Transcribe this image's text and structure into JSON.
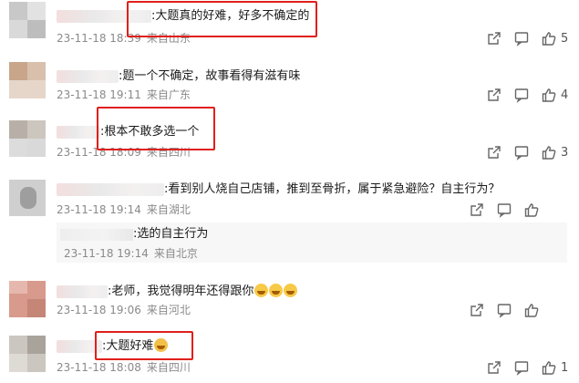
{
  "comments": [
    {
      "text": ":大题真的好难，好多不确定的",
      "date": "23-11-18 18:39",
      "location": "来自山东",
      "likes": "5"
    },
    {
      "text": ":题一个不确定，故事看得有滋有味",
      "date": "23-11-18 19:11",
      "location": "来自广东",
      "likes": "4"
    },
    {
      "text": ":根本不敢多选一个",
      "date": "23-11-18 18:09",
      "location": "来自四川",
      "likes": "3"
    },
    {
      "text": ":看到别人烧自己店铺，推到至骨折，属于紧急避险？自主行为？",
      "date": "23-11-18 19:14",
      "location": "来自湖北",
      "likes": ""
    },
    {
      "text": ":老师，我觉得明年还得跟你",
      "date": "23-11-18 19:06",
      "location": "来自河北",
      "likes": ""
    },
    {
      "text": ":大题好难",
      "date": "23-11-18 18:08",
      "location": "来自四川",
      "likes": "1"
    }
  ],
  "reply": {
    "text": ":选的自主行为",
    "date": "23-11-18 19:14",
    "location": "来自北京"
  },
  "icons": {
    "share": "share-icon",
    "comment": "comment-icon",
    "like": "thumbs-up-icon"
  },
  "colors": {
    "highlight_box": "#e0201b",
    "meta_text": "#8a8a8a"
  }
}
